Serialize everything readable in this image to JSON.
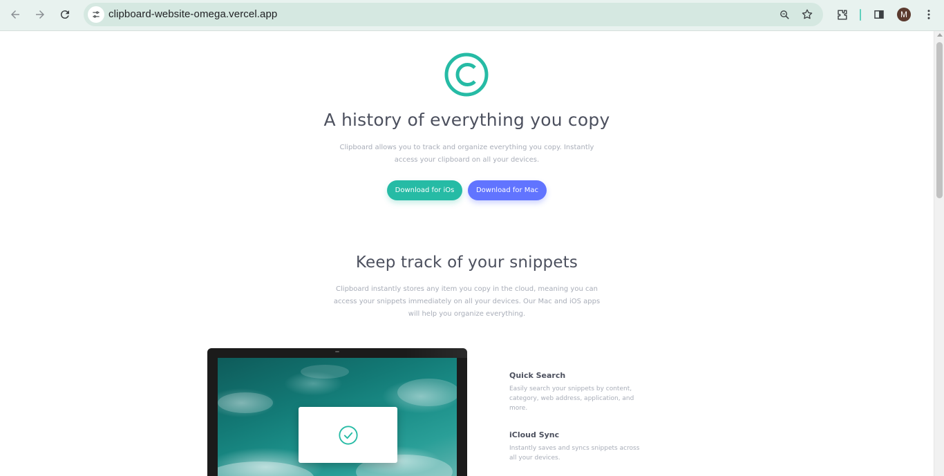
{
  "browser": {
    "url": "clipboard-website-omega.vercel.app",
    "profile_initial": "M",
    "accent_color": "#5fd0bd"
  },
  "hero": {
    "title": "A history of everything you copy",
    "description": "Clipboard allows you to track and organize everything you copy. Instantly access your clipboard on all your devices.",
    "ios_button": "Download for iOs",
    "mac_button": "Download for Mac"
  },
  "snippets": {
    "title": "Keep track of your snippets",
    "description": "Clipboard instantly stores any item you copy in the cloud, meaning you can access your snippets immediately on all your devices. Our Mac and iOS apps will help you organize everything."
  },
  "features": [
    {
      "title": "Quick Search",
      "text": "Easily search your snippets by content, category, web address, application, and more."
    },
    {
      "title": "iCloud Sync",
      "text": "Instantly saves and syncs snippets across all your devices."
    }
  ],
  "colors": {
    "teal": "#26bba5",
    "blue": "#6174ff",
    "heading": "#4c505e",
    "body": "#a8adb8"
  }
}
